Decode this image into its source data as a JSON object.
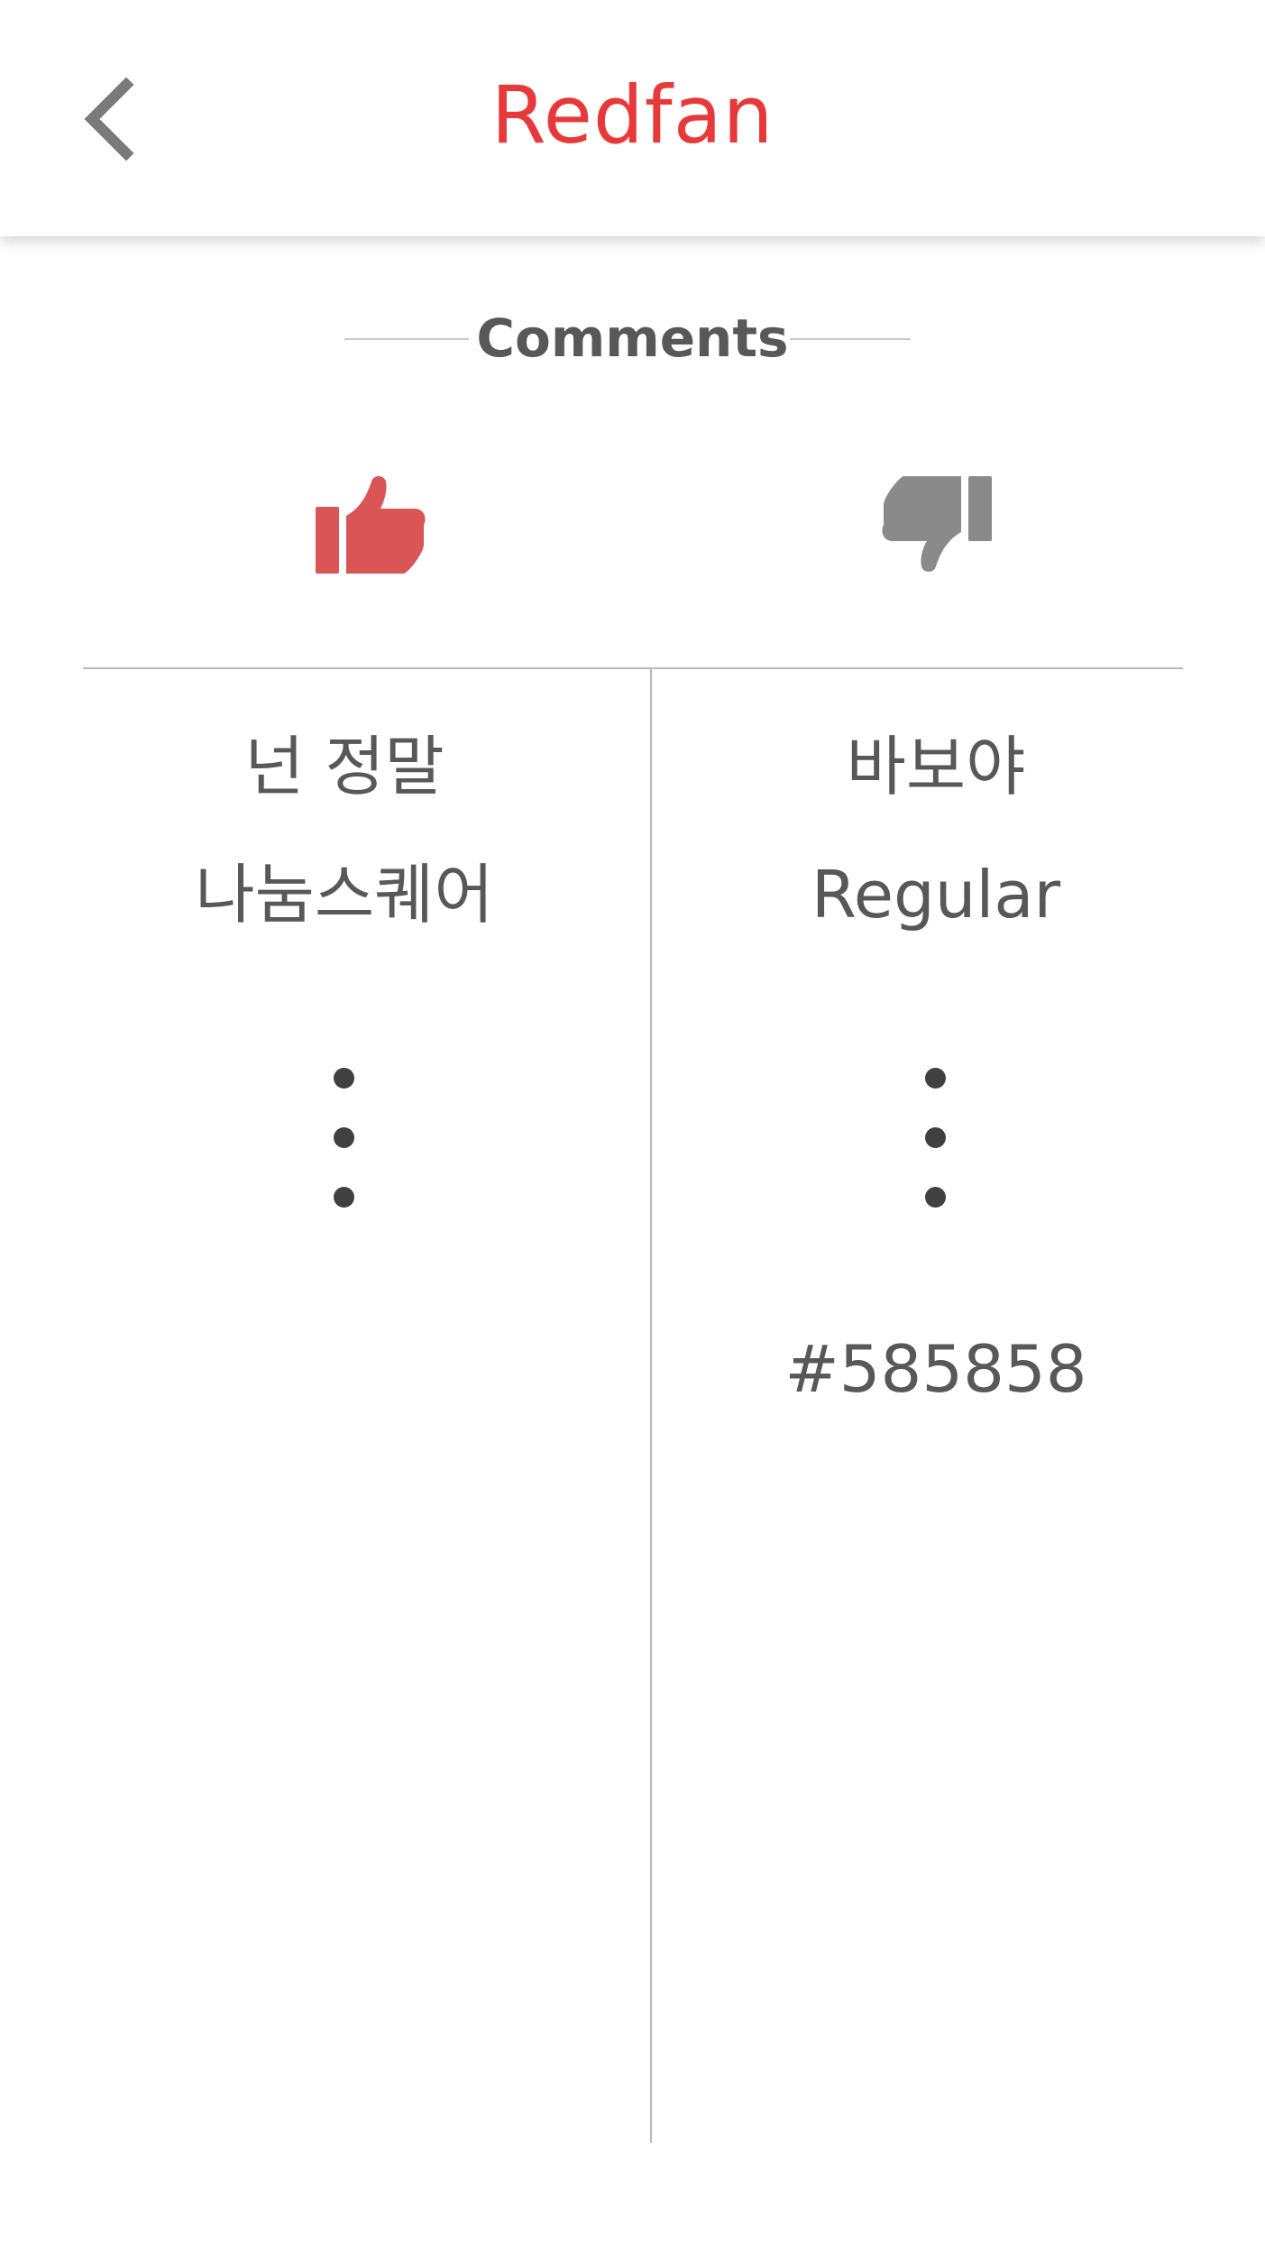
{
  "header": {
    "title": "Redfan",
    "back_icon": "chevron-left-icon",
    "title_color": "#e8393a"
  },
  "comments": {
    "title": "Comments",
    "like_icon": "thumbs-up-icon",
    "dislike_icon": "thumbs-down-icon",
    "like_color": "#d95556",
    "dislike_color": "#8a8a8a"
  },
  "columns": {
    "left": {
      "line1": "넌 정말",
      "line2": "나눔스퀘어"
    },
    "right": {
      "line1": "바보야",
      "line2": "Regular",
      "color_code": "#585858"
    }
  },
  "text_color": "#585858"
}
